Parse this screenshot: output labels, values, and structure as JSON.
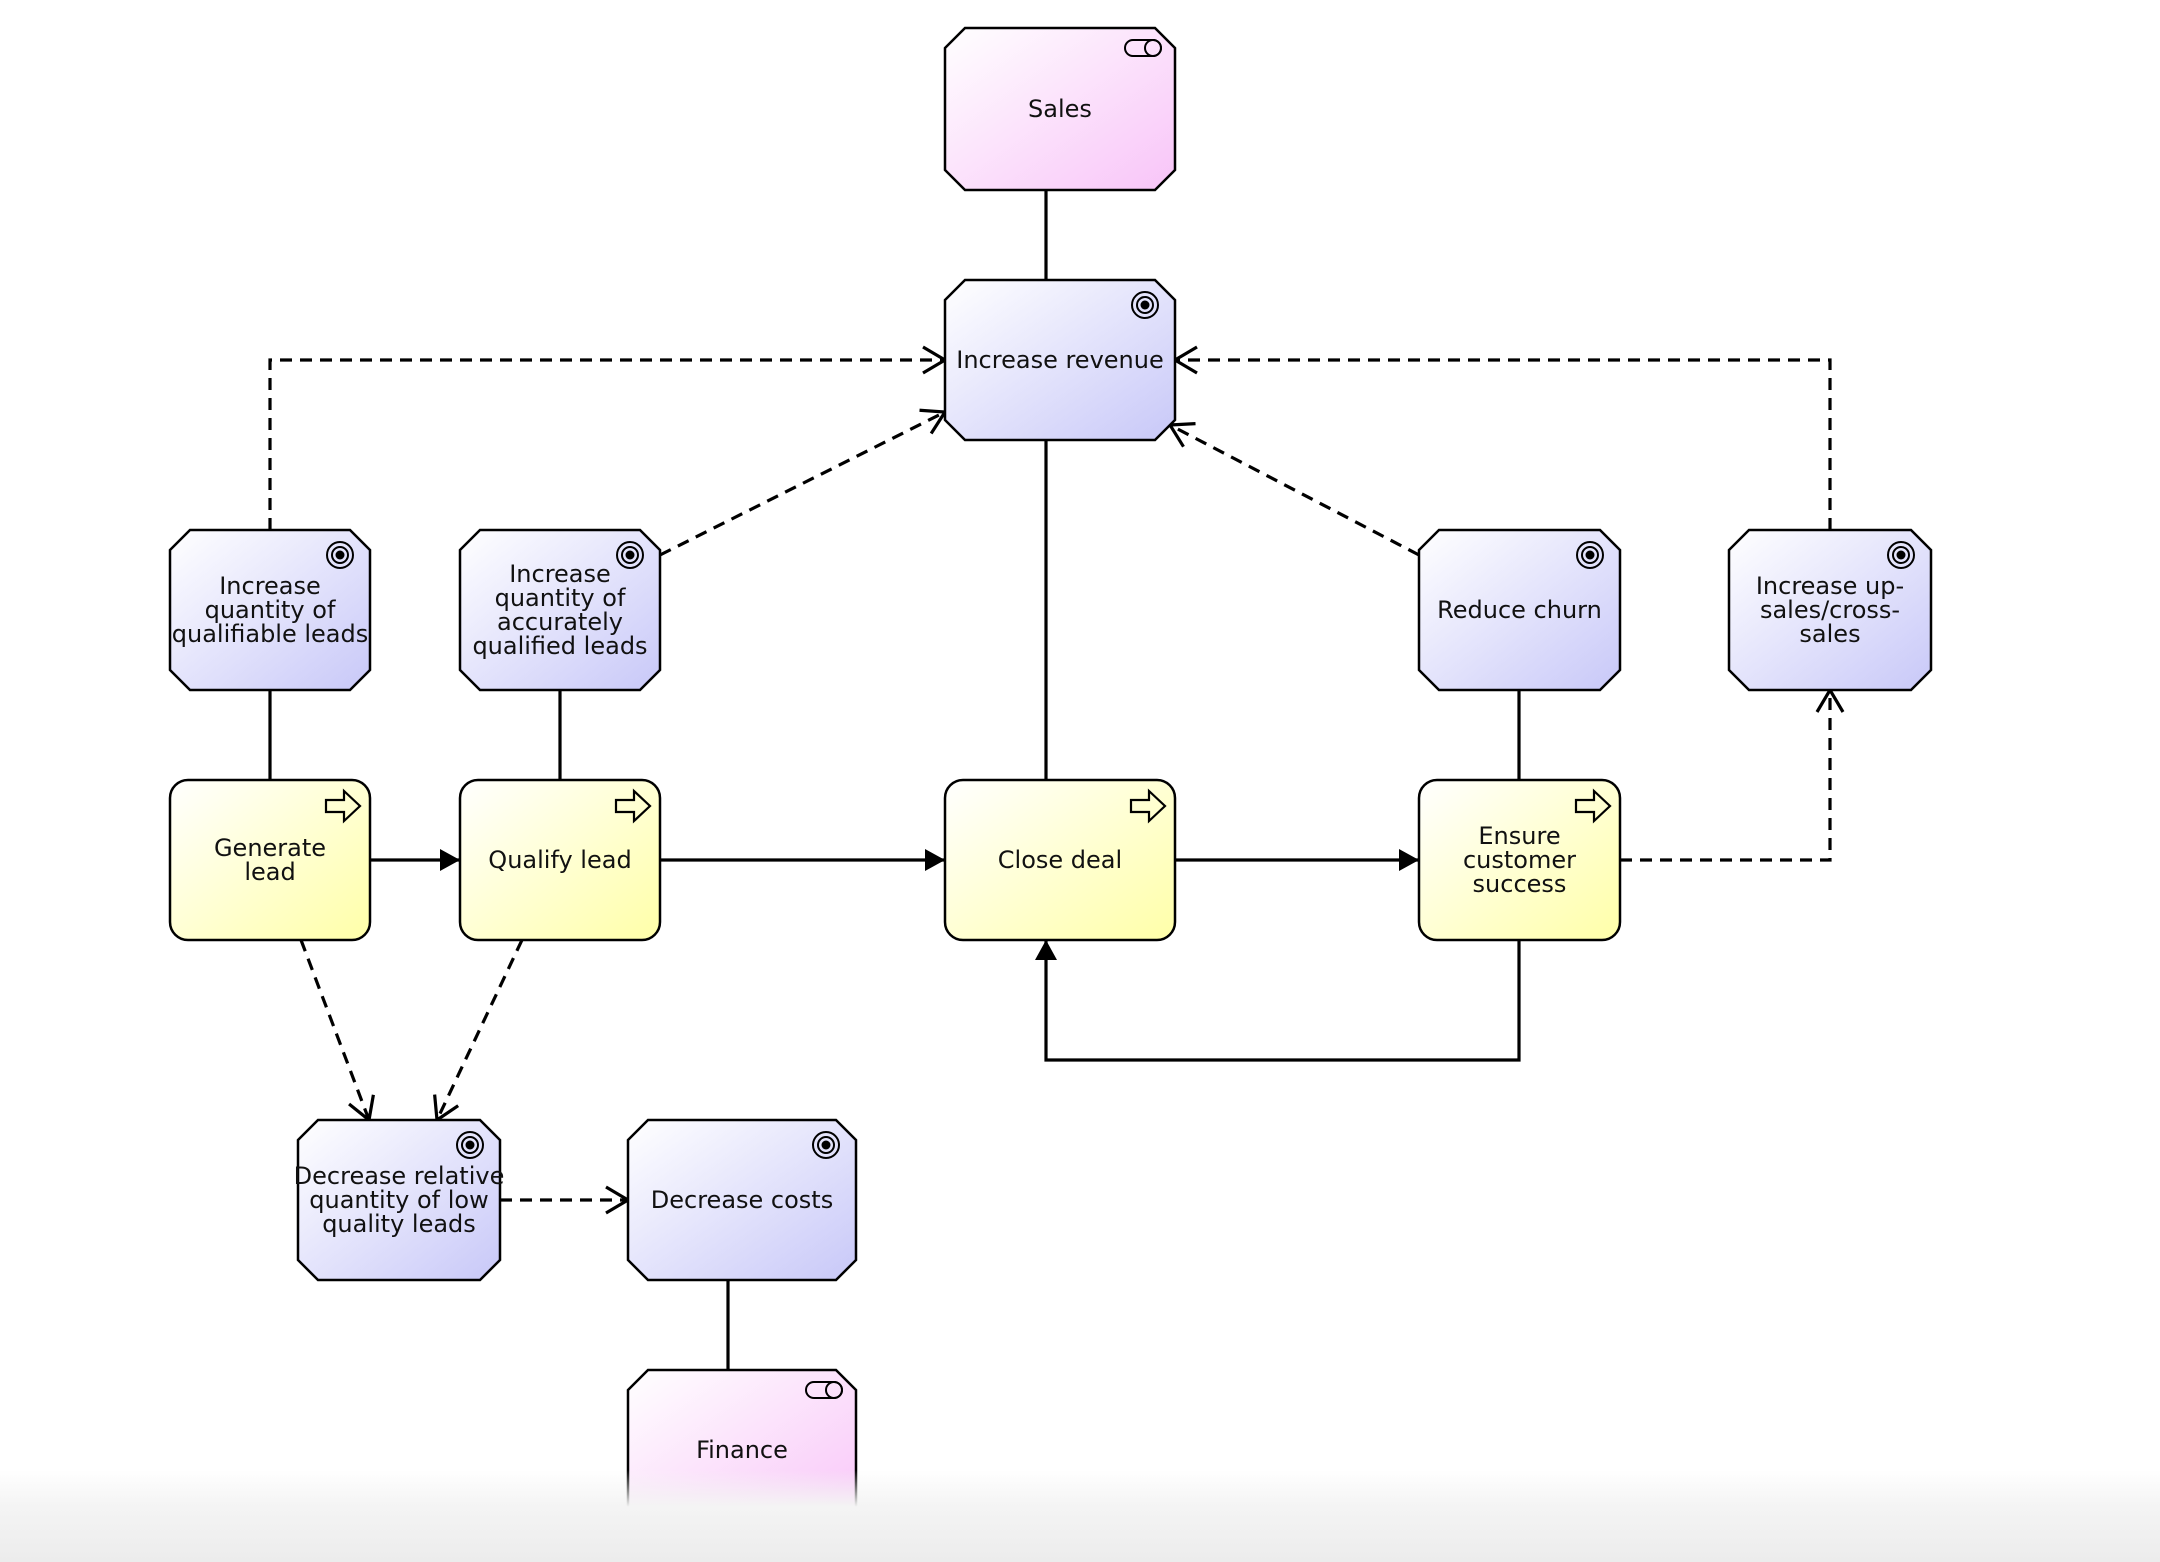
{
  "diagram": {
    "colors": {
      "goal": "#c8c8f8",
      "role": "#f8c4f8",
      "process": "#ffffa8",
      "stroke": "#000000"
    },
    "nodes": [
      {
        "id": "sales",
        "type": "role",
        "label": [
          "Sales"
        ]
      },
      {
        "id": "increase-revenue",
        "type": "goal",
        "label": [
          "Increase revenue"
        ]
      },
      {
        "id": "increase-qualifiable",
        "type": "goal",
        "label": [
          "Increase",
          "quantity of",
          "qualifiable leads"
        ]
      },
      {
        "id": "increase-accurately",
        "type": "goal",
        "label": [
          "Increase",
          "quantity of",
          "accurately",
          "qualified leads"
        ]
      },
      {
        "id": "reduce-churn",
        "type": "goal",
        "label": [
          "Reduce churn"
        ]
      },
      {
        "id": "increase-upsales",
        "type": "goal",
        "label": [
          "Increase up-",
          "sales/cross-",
          "sales"
        ]
      },
      {
        "id": "generate-lead",
        "type": "process",
        "label": [
          "Generate",
          "lead"
        ]
      },
      {
        "id": "qualify-lead",
        "type": "process",
        "label": [
          "Qualify lead"
        ]
      },
      {
        "id": "close-deal",
        "type": "process",
        "label": [
          "Close deal"
        ]
      },
      {
        "id": "ensure-success",
        "type": "process",
        "label": [
          "Ensure",
          "customer",
          "success"
        ]
      },
      {
        "id": "decrease-low-quality",
        "type": "goal",
        "label": [
          "Decrease relative",
          "quantity of low",
          "quality leads"
        ]
      },
      {
        "id": "decrease-costs",
        "type": "goal",
        "label": [
          "Decrease costs"
        ]
      },
      {
        "id": "finance",
        "type": "role",
        "label": [
          "Finance"
        ]
      }
    ],
    "edges": [
      {
        "from": "sales",
        "to": "increase-revenue",
        "kind": "association"
      },
      {
        "from": "close-deal",
        "to": "increase-revenue",
        "kind": "association"
      },
      {
        "from": "increase-qualifiable",
        "to": "generate-lead",
        "kind": "association"
      },
      {
        "from": "increase-accurately",
        "to": "qualify-lead",
        "kind": "association"
      },
      {
        "from": "reduce-churn",
        "to": "ensure-success",
        "kind": "association"
      },
      {
        "from": "decrease-costs",
        "to": "finance",
        "kind": "association"
      },
      {
        "from": "generate-lead",
        "to": "qualify-lead",
        "kind": "triggering"
      },
      {
        "from": "qualify-lead",
        "to": "close-deal",
        "kind": "triggering"
      },
      {
        "from": "close-deal",
        "to": "ensure-success",
        "kind": "triggering"
      },
      {
        "from": "ensure-success",
        "to": "close-deal",
        "kind": "triggering"
      },
      {
        "from": "increase-qualifiable",
        "to": "increase-revenue",
        "kind": "influence"
      },
      {
        "from": "increase-accurately",
        "to": "increase-revenue",
        "kind": "influence"
      },
      {
        "from": "reduce-churn",
        "to": "increase-revenue",
        "kind": "influence"
      },
      {
        "from": "increase-upsales",
        "to": "increase-revenue",
        "kind": "influence"
      },
      {
        "from": "ensure-success",
        "to": "increase-upsales",
        "kind": "influence"
      },
      {
        "from": "generate-lead",
        "to": "decrease-low-quality",
        "kind": "influence"
      },
      {
        "from": "qualify-lead",
        "to": "decrease-low-quality",
        "kind": "influence"
      },
      {
        "from": "decrease-low-quality",
        "to": "decrease-costs",
        "kind": "influence"
      }
    ]
  }
}
